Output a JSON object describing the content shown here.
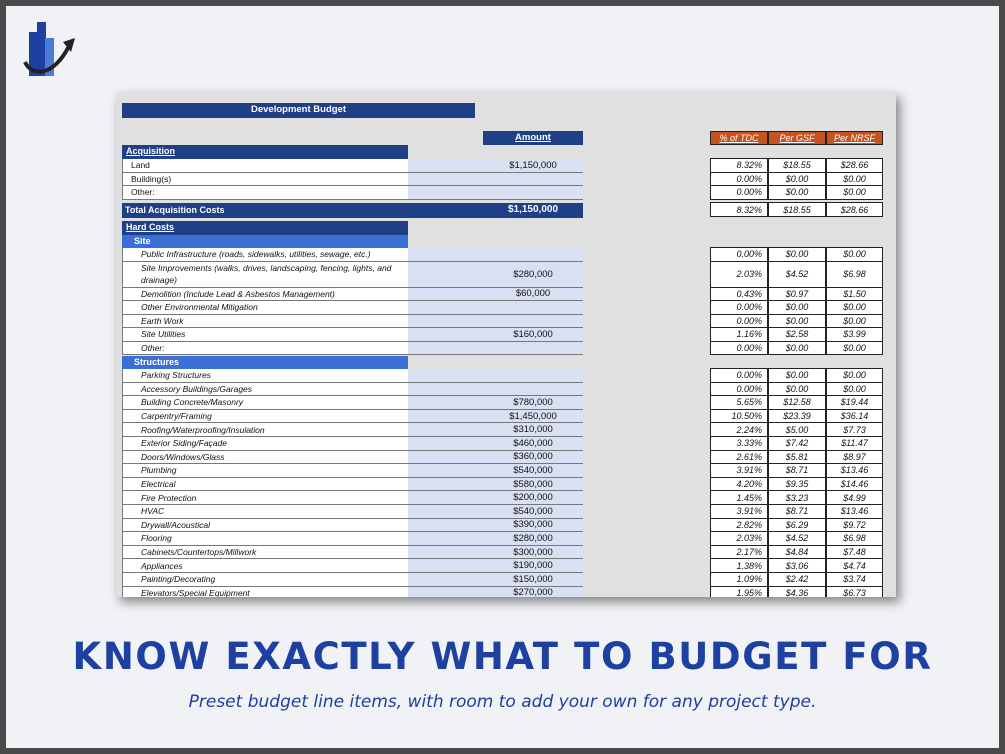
{
  "sheet": {
    "title": "Development Budget",
    "amount_header": "Amount",
    "ratio_headers": [
      "% of TDC",
      "Per GSF",
      "Per NRSF"
    ],
    "acquisition": {
      "label": "Acquisition",
      "rows": [
        {
          "label": "Land",
          "amount": "$1,150,000",
          "pct": "8.32%",
          "gsf": "$18.55",
          "nrsf": "$28.66"
        },
        {
          "label": "Building(s)",
          "amount": "",
          "pct": "0.00%",
          "gsf": "$0.00",
          "nrsf": "$0.00"
        },
        {
          "label": "Other:",
          "amount": "",
          "pct": "0.00%",
          "gsf": "$0.00",
          "nrsf": "$0.00"
        }
      ],
      "total": {
        "label": "Total Acquisition Costs",
        "amount": "$1,150,000",
        "pct": "8.32%",
        "gsf": "$18.55",
        "nrsf": "$28.66"
      }
    },
    "hard_costs": {
      "label": "Hard Costs",
      "site": {
        "label": "Site",
        "rows": [
          {
            "label": "Public Infrastructure (roads, sidewalks, utilities, sewage, etc.)",
            "amount": "",
            "pct": "0.00%",
            "gsf": "$0.00",
            "nrsf": "$0.00"
          },
          {
            "label": "Site Improvements (walks, drives, landscaping, fencing, lights, and drainage)",
            "amount": "$280,000",
            "pct": "2.03%",
            "gsf": "$4.52",
            "nrsf": "$6.98"
          },
          {
            "label": "Demolition (Include Lead & Asbestos Management)",
            "amount": "$60,000",
            "pct": "0.43%",
            "gsf": "$0.97",
            "nrsf": "$1.50"
          },
          {
            "label": "Other Environmental Mitigation",
            "amount": "",
            "pct": "0.00%",
            "gsf": "$0.00",
            "nrsf": "$0.00"
          },
          {
            "label": "Earth Work",
            "amount": "",
            "pct": "0.00%",
            "gsf": "$0.00",
            "nrsf": "$0.00"
          },
          {
            "label": "Site Utilities",
            "amount": "$160,000",
            "pct": "1.16%",
            "gsf": "$2.58",
            "nrsf": "$3.99"
          },
          {
            "label": "Other:",
            "amount": "",
            "pct": "0.00%",
            "gsf": "$0.00",
            "nrsf": "$0.00"
          }
        ]
      },
      "structures": {
        "label": "Structures",
        "rows": [
          {
            "label": "Parking Structures",
            "amount": "",
            "pct": "0.00%",
            "gsf": "$0.00",
            "nrsf": "$0.00"
          },
          {
            "label": "Accessory Buildings/Garages",
            "amount": "",
            "pct": "0.00%",
            "gsf": "$0.00",
            "nrsf": "$0.00"
          },
          {
            "label": "Building Concrete/Masonry",
            "amount": "$780,000",
            "pct": "5.65%",
            "gsf": "$12.58",
            "nrsf": "$19.44"
          },
          {
            "label": "Carpentry/Framing",
            "amount": "$1,450,000",
            "pct": "10.50%",
            "gsf": "$23.39",
            "nrsf": "$36.14"
          },
          {
            "label": "Roofing/Waterproofing/Insulation",
            "amount": "$310,000",
            "pct": "2.24%",
            "gsf": "$5.00",
            "nrsf": "$7.73"
          },
          {
            "label": "Exterior Siding/Façade",
            "amount": "$460,000",
            "pct": "3.33%",
            "gsf": "$7.42",
            "nrsf": "$11.47"
          },
          {
            "label": "Doors/Windows/Glass",
            "amount": "$360,000",
            "pct": "2.61%",
            "gsf": "$5.81",
            "nrsf": "$8.97"
          },
          {
            "label": "Plumbing",
            "amount": "$540,000",
            "pct": "3.91%",
            "gsf": "$8.71",
            "nrsf": "$13.46"
          },
          {
            "label": "Electrical",
            "amount": "$580,000",
            "pct": "4.20%",
            "gsf": "$9.35",
            "nrsf": "$14.46"
          },
          {
            "label": "Fire Protection",
            "amount": "$200,000",
            "pct": "1.45%",
            "gsf": "$3.23",
            "nrsf": "$4.99"
          },
          {
            "label": "HVAC",
            "amount": "$540,000",
            "pct": "3.91%",
            "gsf": "$8.71",
            "nrsf": "$13.46"
          },
          {
            "label": "Drywall/Acoustical",
            "amount": "$390,000",
            "pct": "2.82%",
            "gsf": "$6.29",
            "nrsf": "$9.72"
          },
          {
            "label": "Flooring",
            "amount": "$280,000",
            "pct": "2.03%",
            "gsf": "$4.52",
            "nrsf": "$6.98"
          },
          {
            "label": "Cabinets/Countertops/Millwork",
            "amount": "$300,000",
            "pct": "2.17%",
            "gsf": "$4.84",
            "nrsf": "$7.48"
          },
          {
            "label": "Appliances",
            "amount": "$190,000",
            "pct": "1.38%",
            "gsf": "$3.06",
            "nrsf": "$4.74"
          },
          {
            "label": "Painting/Decorating",
            "amount": "$150,000",
            "pct": "1.09%",
            "gsf": "$2.42",
            "nrsf": "$3.74"
          },
          {
            "label": "Elevators/Special Equipment",
            "amount": "$270,000",
            "pct": "1.95%",
            "gsf": "$4.36",
            "nrsf": "$6.73"
          }
        ]
      }
    }
  },
  "headline": "KNOW EXACTLY WHAT TO BUDGET FOR",
  "subline": "Preset budget line items, with room to add your own for any project type.",
  "colors": {
    "navy": "#1f3f86",
    "blue": "#3c6fd6",
    "orange": "#c5521f",
    "accent_text": "#1e40a0"
  },
  "logo_icon": "bar-chart-arrow-icon"
}
